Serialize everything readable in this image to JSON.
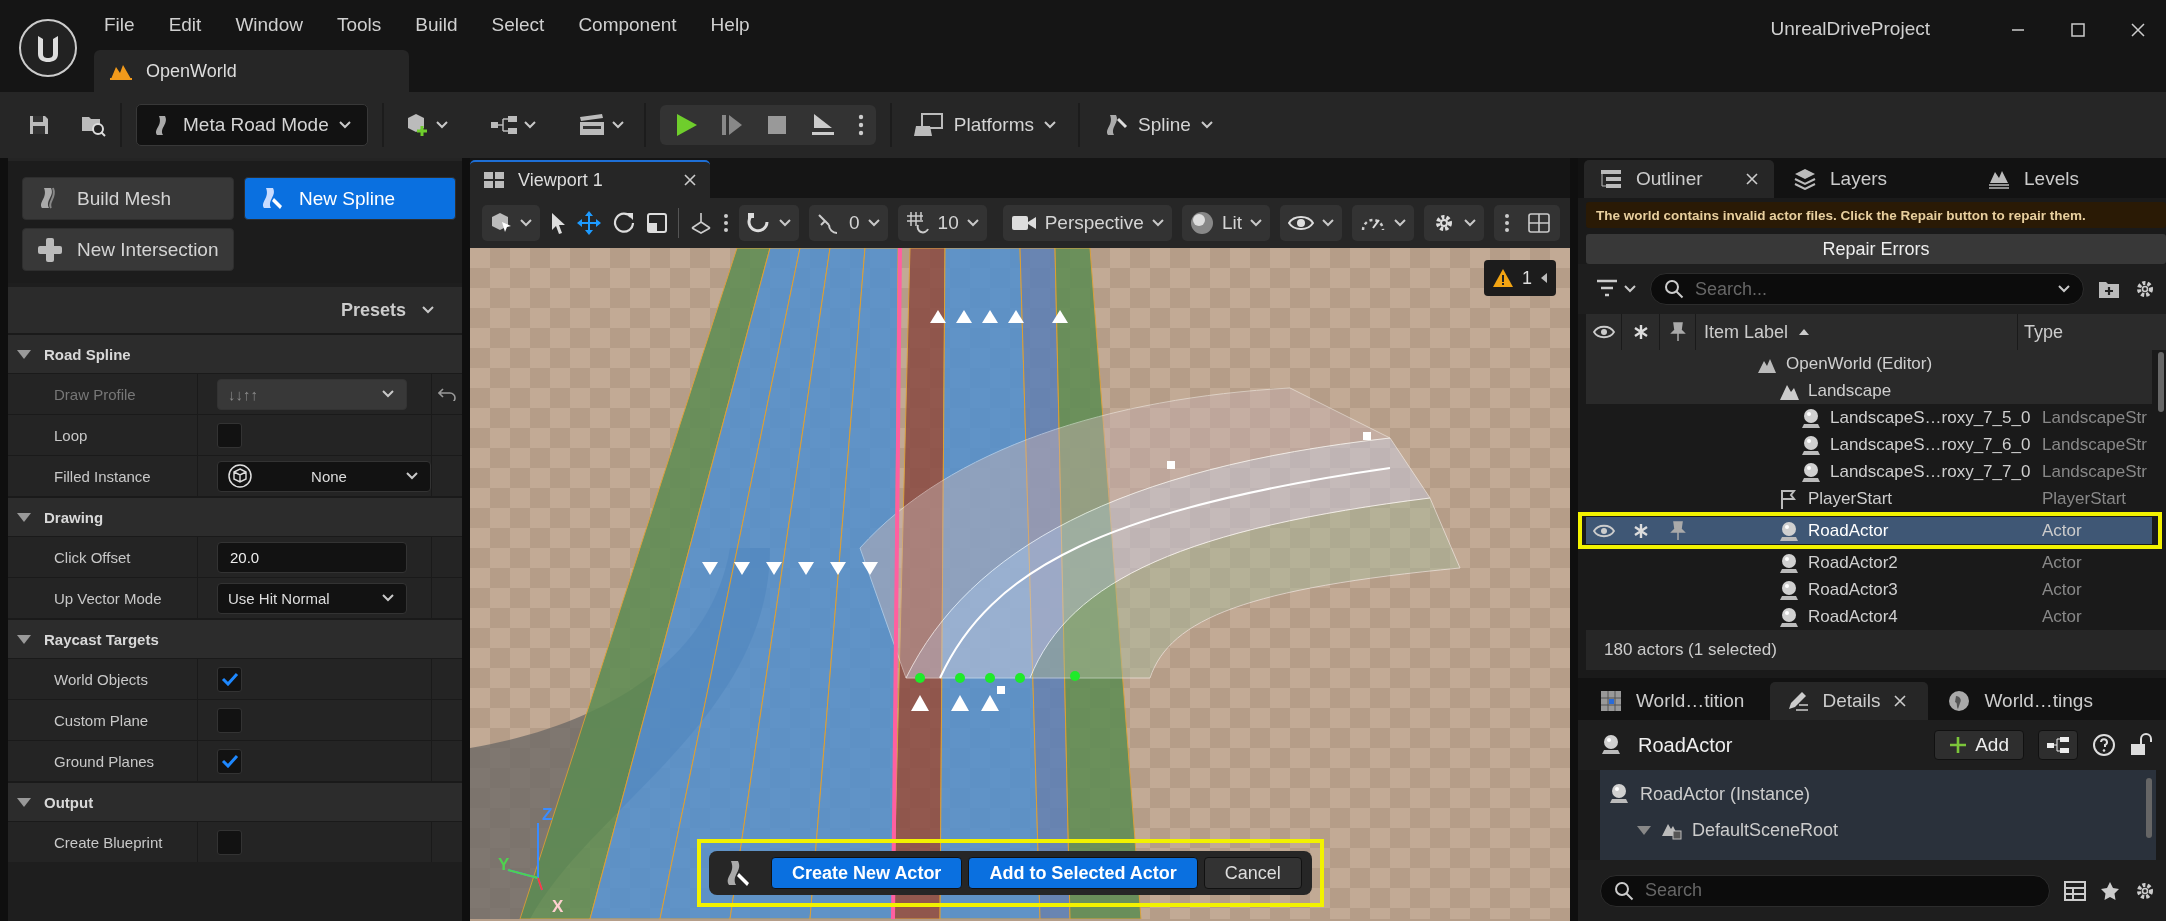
{
  "title_bar": {
    "menus": [
      "File",
      "Edit",
      "Window",
      "Tools",
      "Build",
      "Select",
      "Component",
      "Help"
    ],
    "level_tab": "OpenWorld",
    "project": "UnrealDriveProject"
  },
  "toolbar": {
    "mode": "Meta Road Mode",
    "platforms": "Platforms",
    "spline": "Spline"
  },
  "tool_panel": {
    "buttons": [
      {
        "label": "Build Mesh",
        "kind": "build",
        "selected": false
      },
      {
        "label": "New Spline",
        "kind": "spline",
        "selected": true
      },
      {
        "label": "New Intersection",
        "kind": "intersection",
        "selected": false
      }
    ],
    "presets": "Presets",
    "sections": [
      {
        "title": "Road Spline",
        "expanded": true,
        "rows": [
          {
            "kind": "dropdown",
            "label": "Draw Profile",
            "value": "↓↓↑↑",
            "disabled": true
          },
          {
            "kind": "checkbox",
            "label": "Loop",
            "checked": false,
            "disabled": false
          },
          {
            "kind": "asset",
            "label": "Filled Instance",
            "value": "None",
            "disabled": false
          }
        ]
      },
      {
        "title": "Drawing",
        "expanded": true,
        "rows": [
          {
            "kind": "number",
            "label": "Click Offset",
            "value": "20.0",
            "disabled": false
          },
          {
            "kind": "dropdown",
            "label": "Up Vector Mode",
            "value": "Use Hit Normal",
            "disabled": false
          }
        ]
      },
      {
        "title": "Raycast Targets",
        "expanded": true,
        "rows": [
          {
            "kind": "checkbox",
            "label": "World Objects",
            "checked": true,
            "disabled": false
          },
          {
            "kind": "checkbox",
            "label": "Custom Plane",
            "checked": false,
            "disabled": false
          },
          {
            "kind": "checkbox",
            "label": "Ground Planes",
            "checked": true,
            "disabled": false
          }
        ]
      },
      {
        "title": "Output",
        "expanded": true,
        "rows": [
          {
            "kind": "checkbox",
            "label": "Create Blueprint",
            "checked": false,
            "disabled": false
          }
        ]
      }
    ]
  },
  "viewport": {
    "tab": "Viewport 1",
    "angle_snap": "0",
    "grid_snap": "10",
    "projection": "Perspective",
    "view_mode": "Lit",
    "warnings": "1",
    "gizmo": [
      "X",
      "Y",
      "Z"
    ],
    "action_bar": {
      "highlighted": true,
      "buttons": [
        {
          "label": "Create New Actor",
          "kind": "primary"
        },
        {
          "label": "Add to Selected Actor",
          "kind": "primary"
        },
        {
          "label": "Cancel",
          "kind": "secondary"
        }
      ]
    }
  },
  "outliner": {
    "tabs": [
      {
        "label": "Outliner",
        "selected": true
      },
      {
        "label": "Layers",
        "selected": false
      },
      {
        "label": "Levels",
        "selected": false
      }
    ],
    "warning": "The world contains invalid actor files. Click the Repair button to repair them.",
    "repair_button": "Repair Errors",
    "search": {
      "placeholder": "Search..."
    },
    "columns": [
      "Item Label",
      "Type"
    ],
    "tree": [
      {
        "label": "OpenWorld (Editor)",
        "kind": "level",
        "selected": false,
        "highlighted": false,
        "children": [
          {
            "label": "Landscape",
            "kind": "landscape",
            "selected": false,
            "highlighted": false,
            "children": [
              {
                "label": "LandscapeS…roxy_7_5_0",
                "type": "LandscapeStr",
                "kind": "actor",
                "selected": false,
                "highlighted": false
              },
              {
                "label": "LandscapeS…roxy_7_6_0",
                "type": "LandscapeStr",
                "kind": "actor",
                "selected": false,
                "highlighted": false
              },
              {
                "label": "LandscapeS…roxy_7_7_0",
                "type": "LandscapeStr",
                "kind": "actor",
                "selected": false,
                "highlighted": false
              }
            ]
          },
          {
            "label": "PlayerStart",
            "type": "PlayerStart",
            "kind": "player_start",
            "selected": false,
            "highlighted": false
          },
          {
            "label": "RoadActor",
            "type": "Actor",
            "kind": "actor",
            "selected": true,
            "highlighted": true
          },
          {
            "label": "RoadActor2",
            "type": "Actor",
            "kind": "actor",
            "selected": false,
            "highlighted": false
          },
          {
            "label": "RoadActor3",
            "type": "Actor",
            "kind": "actor",
            "selected": false,
            "highlighted": false
          },
          {
            "label": "RoadActor4",
            "type": "Actor",
            "kind": "actor",
            "selected": false,
            "highlighted": false
          }
        ]
      }
    ],
    "status": "180 actors (1 selected)"
  },
  "details": {
    "tabs": [
      {
        "label": "World…tition",
        "kind": "partition",
        "selected": false
      },
      {
        "label": "Details",
        "kind": "details",
        "selected": true
      },
      {
        "label": "World…tings",
        "kind": "settings",
        "selected": false
      }
    ],
    "actor": "RoadActor",
    "add_button": "Add",
    "components": [
      {
        "label": "RoadActor (Instance)",
        "kind": "actor",
        "children": [
          {
            "label": "DefaultSceneRoot",
            "kind": "scene_root",
            "expanded": true
          }
        ]
      }
    ],
    "search": {
      "placeholder": "Search"
    }
  }
}
